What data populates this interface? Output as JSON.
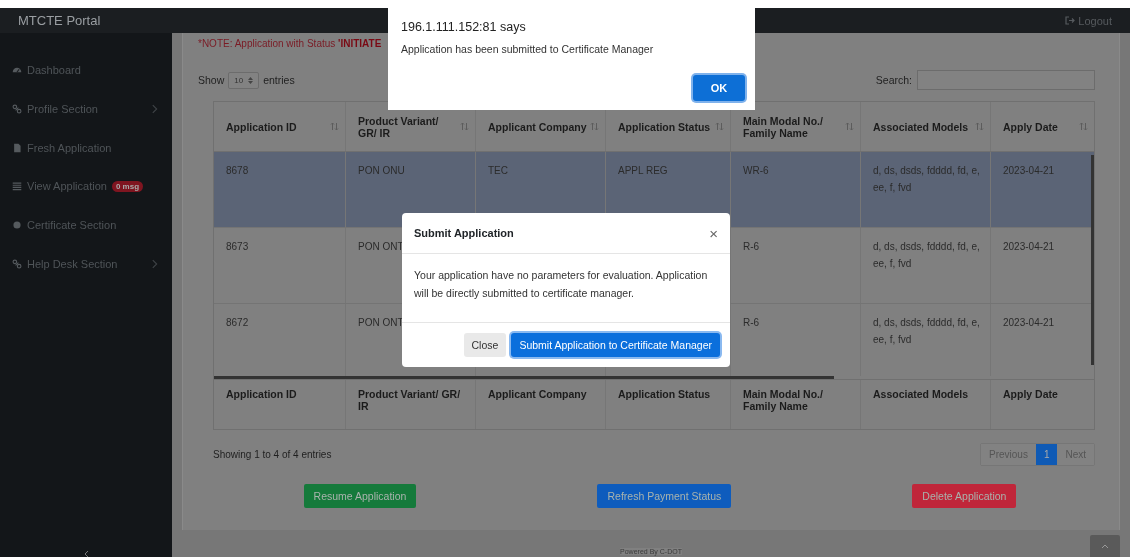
{
  "navbar": {
    "brand": "MTCTE Portal",
    "logout": "Logout"
  },
  "sidebar": {
    "items": [
      {
        "label": "Dashboard",
        "submenu": false
      },
      {
        "label": "Profile Section",
        "submenu": true
      },
      {
        "label": "Fresh Application",
        "submenu": false
      },
      {
        "label": "View Application",
        "submenu": false,
        "badge": "0 msg"
      },
      {
        "label": "Certificate Section",
        "submenu": false
      },
      {
        "label": "Help Desk Section",
        "submenu": true
      }
    ]
  },
  "note": "*NOTE: Application with Status **'INITIATE**",
  "length_menu": {
    "label_before": "Show",
    "value": "10",
    "label_after": "entries"
  },
  "search": {
    "label": "Search:"
  },
  "table": {
    "columns": [
      "Application ID",
      "Product Variant/ GR/ IR",
      "Applicant Company",
      "Application Status",
      "Main Modal No./ Family Name",
      "Associated Models",
      "Apply Date"
    ],
    "rows": [
      {
        "selected": true,
        "cells": [
          "8678",
          "PON ONU",
          "TEC",
          "APPL REG",
          "WR-6",
          "d, ds, dsds, fdddd, fd, e, ee, f, fvd",
          "2023-04-21"
        ]
      },
      {
        "selected": false,
        "cells": [
          "8673",
          "PON ONT",
          "",
          "",
          "R-6",
          "d, ds, dsds, fdddd, fd, e, ee, f, fvd",
          "2023-04-21"
        ]
      },
      {
        "selected": false,
        "cells": [
          "8672",
          "PON ONT",
          "",
          "",
          "R-6",
          "d, ds, dsds, fdddd, fd, e, ee, f, fvd",
          "2023-04-21"
        ]
      }
    ],
    "footer_columns": [
      "Application ID",
      "Product Variant/ GR/ IR",
      "Applicant Company",
      "Application Status",
      "Main Modal No./ Family Name",
      "Associated Models",
      "Apply Date"
    ]
  },
  "info": "Showing 1 to 4 of 4 entries",
  "pagination": [
    {
      "label": "Previous",
      "selected": false
    },
    {
      "label": "1",
      "selected": true
    },
    {
      "label": "Next",
      "selected": false
    }
  ],
  "actions": [
    {
      "label": "Resume Application",
      "color": "#157a3b"
    },
    {
      "label": "Refresh Payment Status",
      "color": "#0e5cbd"
    },
    {
      "label": "Delete Application",
      "color": "#c0263a"
    }
  ],
  "footer": "Powered By C-DOT",
  "modal": {
    "title": "Submit Application",
    "close": "×",
    "body": "Your application have no parameters for evaluation. Application will be directly submitted to certificate manager.",
    "buttons": [
      {
        "label": "Close",
        "kind": "secondary"
      },
      {
        "label": "Submit Application to Certificate Manager",
        "kind": "primary"
      }
    ]
  },
  "alert": {
    "title": "196.1.111.152:81 says",
    "message": "Application has been submitted to Certificate Manager",
    "button": "OK"
  }
}
